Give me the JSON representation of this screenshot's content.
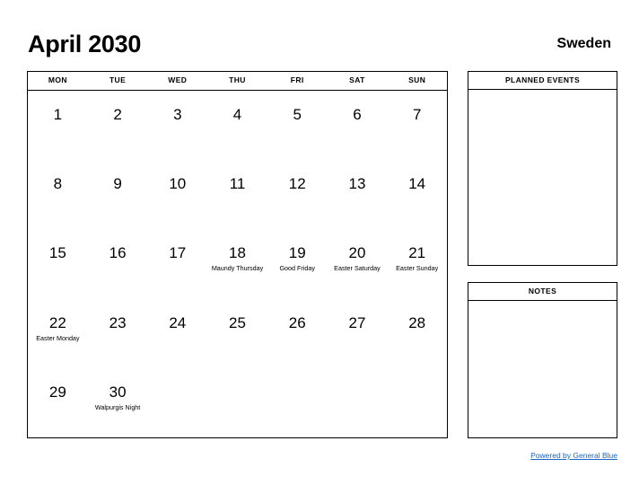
{
  "header": {
    "month_title": "April 2030",
    "country": "Sweden"
  },
  "calendar": {
    "weekdays": [
      "MON",
      "TUE",
      "WED",
      "THU",
      "FRI",
      "SAT",
      "SUN"
    ],
    "weeks": [
      [
        {
          "num": "1",
          "event": ""
        },
        {
          "num": "2",
          "event": ""
        },
        {
          "num": "3",
          "event": ""
        },
        {
          "num": "4",
          "event": ""
        },
        {
          "num": "5",
          "event": ""
        },
        {
          "num": "6",
          "event": ""
        },
        {
          "num": "7",
          "event": ""
        }
      ],
      [
        {
          "num": "8",
          "event": ""
        },
        {
          "num": "9",
          "event": ""
        },
        {
          "num": "10",
          "event": ""
        },
        {
          "num": "11",
          "event": ""
        },
        {
          "num": "12",
          "event": ""
        },
        {
          "num": "13",
          "event": ""
        },
        {
          "num": "14",
          "event": ""
        }
      ],
      [
        {
          "num": "15",
          "event": ""
        },
        {
          "num": "16",
          "event": ""
        },
        {
          "num": "17",
          "event": ""
        },
        {
          "num": "18",
          "event": "Maundy Thursday"
        },
        {
          "num": "19",
          "event": "Good Friday"
        },
        {
          "num": "20",
          "event": "Easter Saturday"
        },
        {
          "num": "21",
          "event": "Easter Sunday"
        }
      ],
      [
        {
          "num": "22",
          "event": "Easter Monday"
        },
        {
          "num": "23",
          "event": ""
        },
        {
          "num": "24",
          "event": ""
        },
        {
          "num": "25",
          "event": ""
        },
        {
          "num": "26",
          "event": ""
        },
        {
          "num": "27",
          "event": ""
        },
        {
          "num": "28",
          "event": ""
        }
      ],
      [
        {
          "num": "29",
          "event": ""
        },
        {
          "num": "30",
          "event": "Walpurgis Night"
        },
        {
          "num": "",
          "event": ""
        },
        {
          "num": "",
          "event": ""
        },
        {
          "num": "",
          "event": ""
        },
        {
          "num": "",
          "event": ""
        },
        {
          "num": "",
          "event": ""
        }
      ]
    ]
  },
  "panels": {
    "planned_events_title": "PLANNED EVENTS",
    "notes_title": "NOTES"
  },
  "footer": {
    "link_label": "Powered by General Blue"
  },
  "colors": {
    "text": "#000000",
    "link": "#1a66c2",
    "border": "#000000",
    "background": "#ffffff"
  }
}
